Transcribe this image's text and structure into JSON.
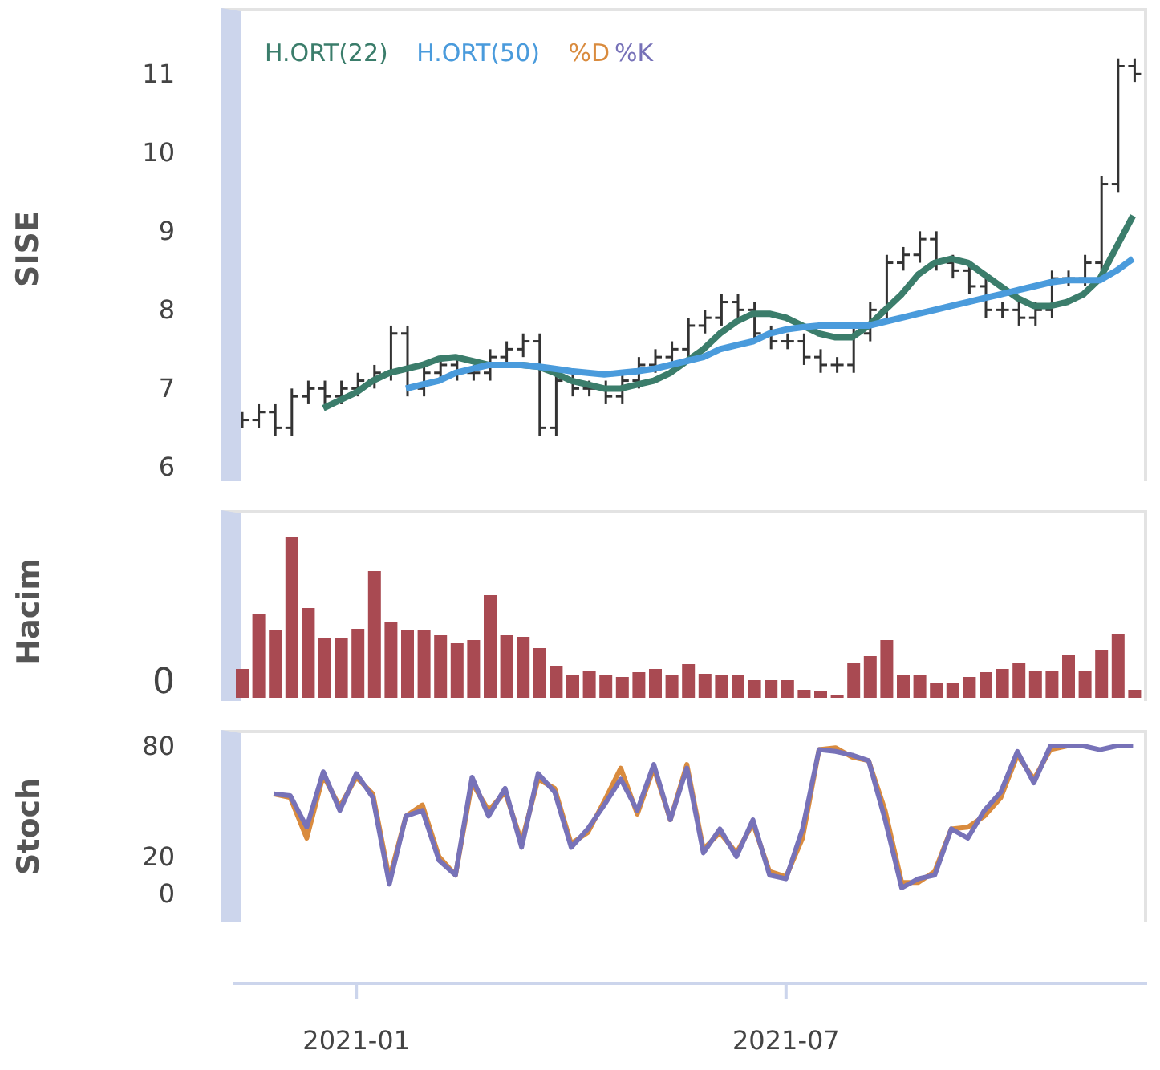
{
  "price_panel": {
    "label": "SISE",
    "chart_data": {
      "type": "line",
      "ylim": [
        5.82,
        11.84
      ],
      "yticks": [
        6,
        7,
        8,
        9,
        10,
        11
      ],
      "series": [
        {
          "name": "H.ORT(22)",
          "color": "#3b7d6b",
          "values": [
            null,
            null,
            null,
            null,
            null,
            6.75,
            6.85,
            6.95,
            7.1,
            7.2,
            7.25,
            7.3,
            7.38,
            7.4,
            7.35,
            7.3,
            7.3,
            7.3,
            7.28,
            7.2,
            7.1,
            7.05,
            7.0,
            7.0,
            7.05,
            7.1,
            7.2,
            7.35,
            7.5,
            7.7,
            7.85,
            7.95,
            7.95,
            7.9,
            7.8,
            7.7,
            7.65,
            7.65,
            7.8,
            8.0,
            8.2,
            8.45,
            8.6,
            8.65,
            8.6,
            8.45,
            8.3,
            8.15,
            8.05,
            8.05,
            8.1,
            8.2,
            8.4,
            8.8,
            9.2
          ]
        },
        {
          "name": "H.ORT(50)",
          "color": "#4a9bdc",
          "values": [
            null,
            null,
            null,
            null,
            null,
            null,
            null,
            null,
            null,
            null,
            7.0,
            7.05,
            7.1,
            7.2,
            7.25,
            7.3,
            7.3,
            7.3,
            7.28,
            7.25,
            7.22,
            7.2,
            7.18,
            7.2,
            7.22,
            7.25,
            7.3,
            7.35,
            7.4,
            7.5,
            7.55,
            7.6,
            7.7,
            7.75,
            7.78,
            7.8,
            7.8,
            7.8,
            7.8,
            7.85,
            7.9,
            7.95,
            8.0,
            8.05,
            8.1,
            8.15,
            8.2,
            8.25,
            8.3,
            8.35,
            8.38,
            8.38,
            8.38,
            8.5,
            8.65
          ]
        }
      ]
    }
  },
  "volume_panel": {
    "label": "Hacim",
    "tick": "0"
  },
  "stoch_panel": {
    "label": "Stoch",
    "chart_data": {
      "type": "line",
      "ylim": [
        -15.7,
        88.7
      ],
      "yticks": [
        0,
        20,
        80
      ],
      "series": [
        {
          "name": "%D",
          "color": "#d98b3e",
          "values": [
            null,
            null,
            54,
            52,
            30,
            64,
            47,
            63,
            54,
            8,
            42,
            48,
            20,
            10,
            60,
            45,
            55,
            28,
            62,
            57,
            27,
            33,
            50,
            68,
            43,
            68,
            40,
            70,
            24,
            33,
            22,
            38,
            12,
            9,
            30,
            78,
            79,
            74,
            72,
            45,
            6,
            6,
            12,
            35,
            36,
            42,
            52,
            75,
            62,
            78,
            80,
            null,
            null,
            null,
            null
          ]
        },
        {
          "name": "%K",
          "color": "#7772b8",
          "values": [
            null,
            null,
            54,
            53,
            36,
            66,
            45,
            65,
            52,
            5,
            42,
            45,
            18,
            10,
            63,
            42,
            57,
            25,
            65,
            55,
            25,
            35,
            48,
            62,
            45,
            70,
            40,
            68,
            22,
            35,
            20,
            40,
            10,
            8,
            35,
            78,
            77,
            75,
            72,
            40,
            3,
            8,
            10,
            35,
            30,
            45,
            55,
            77,
            60,
            80,
            80,
            80,
            78,
            80,
            80
          ]
        }
      ]
    }
  },
  "x_axis": {
    "labels": [
      "2021-01",
      "2021-07"
    ]
  }
}
